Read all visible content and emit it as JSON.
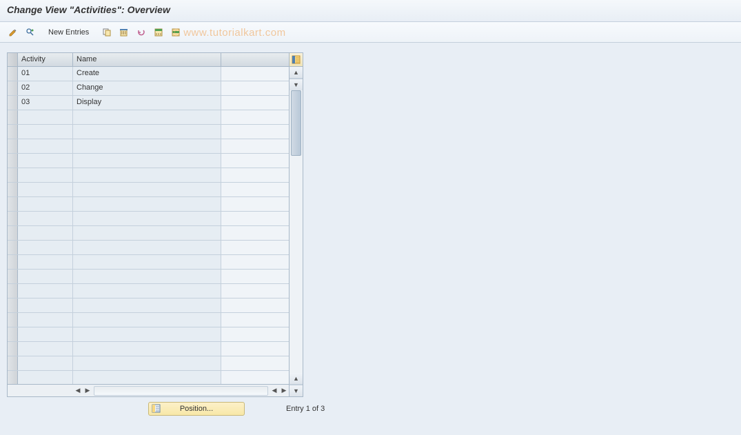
{
  "title": "Change View \"Activities\": Overview",
  "toolbar": {
    "new_entries_label": "New Entries"
  },
  "watermark": "© www.tutorialkart.com",
  "table": {
    "headers": {
      "activity": "Activity",
      "name": "Name"
    },
    "rows": [
      {
        "activity": "01",
        "name": "Create"
      },
      {
        "activity": "02",
        "name": "Change"
      },
      {
        "activity": "03",
        "name": "Display"
      }
    ]
  },
  "footer": {
    "position_label": "Position...",
    "entry_status": "Entry 1 of 3"
  }
}
